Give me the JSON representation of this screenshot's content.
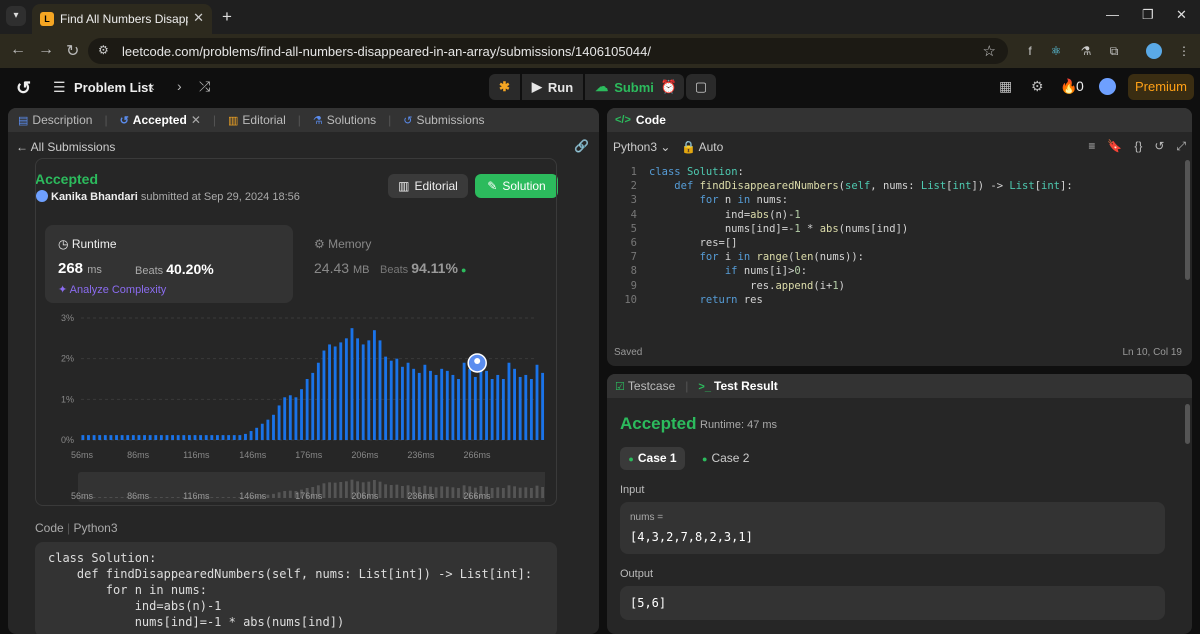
{
  "browser": {
    "tab_title": "Find All Numbers Disappeared in an Array",
    "url": "leetcode.com/problems/find-all-numbers-disappeared-in-an-array/submissions/1406105044/"
  },
  "header": {
    "problem_list": "Problem List",
    "run_label": "Run",
    "submit_label": "Submit",
    "streak_count": "0",
    "premium_label": "Premium"
  },
  "left_tabs": [
    {
      "label": "Description"
    },
    {
      "label": "Accepted"
    },
    {
      "label": "Editorial"
    },
    {
      "label": "Solutions"
    },
    {
      "label": "Submissions"
    }
  ],
  "submission": {
    "back_label": "All Submissions",
    "status": "Accepted",
    "user": "Kanika Bhandari",
    "submitted_text": "submitted at Sep 29, 2024 18:56",
    "editorial_btn": "Editorial",
    "solution_btn": "Solution",
    "runtime_label": "Runtime",
    "runtime_value": "268",
    "runtime_unit": "ms",
    "beats_label": "Beats",
    "runtime_beats": "40.20%",
    "analyze_label": "Analyze Complexity",
    "memory_label": "Memory",
    "memory_value": "24.43",
    "memory_unit": "MB",
    "memory_beats": "94.11%",
    "code_label": "Code",
    "code_lang": "Python3"
  },
  "chart_data": {
    "type": "bar",
    "y_ticks": [
      "0%",
      "1%",
      "2%",
      "3%"
    ],
    "ylim": [
      0,
      3
    ],
    "x_ticks": [
      "56ms",
      "86ms",
      "116ms",
      "146ms",
      "176ms",
      "206ms",
      "236ms",
      "266ms"
    ],
    "xlim": [
      56,
      300
    ],
    "bin_width_ms": 3,
    "x_start_ms": 57,
    "highlight_runtime_ms": 268,
    "values": [
      0.12,
      0.12,
      0.12,
      0.12,
      0.12,
      0.12,
      0.12,
      0.12,
      0.12,
      0.12,
      0.12,
      0.12,
      0.12,
      0.12,
      0.12,
      0.12,
      0.12,
      0.12,
      0.12,
      0.12,
      0.12,
      0.12,
      0.12,
      0.12,
      0.12,
      0.12,
      0.12,
      0.12,
      0.12,
      0.15,
      0.22,
      0.3,
      0.4,
      0.5,
      0.62,
      0.85,
      1.05,
      1.1,
      1.05,
      1.25,
      1.5,
      1.65,
      1.9,
      2.2,
      2.35,
      2.3,
      2.4,
      2.5,
      2.75,
      2.5,
      2.35,
      2.45,
      2.7,
      2.45,
      2.05,
      1.95,
      2.0,
      1.8,
      1.9,
      1.75,
      1.65,
      1.85,
      1.7,
      1.6,
      1.75,
      1.7,
      1.6,
      1.5,
      1.9,
      1.75,
      1.55,
      1.8,
      1.7,
      1.5,
      1.6,
      1.5,
      1.9,
      1.75,
      1.55,
      1.6,
      1.5,
      1.85,
      1.65,
      1.3,
      1.55,
      1.45,
      1.9,
      1.8,
      1.65,
      1.6,
      1.25,
      1.1,
      1.15,
      1.0,
      0.8,
      0.95,
      1.0,
      1.9,
      1.35
    ]
  },
  "submitted_code": [
    "class Solution:",
    "    def findDisappearedNumbers(self, nums: List[int]) -> List[int]:",
    "        for n in nums:",
    "            ind=abs(n)-1",
    "            nums[ind]=-1 * abs(nums[ind])"
  ],
  "editor": {
    "title": "Code",
    "language": "Python3",
    "auto_label": "Auto",
    "line_numbers": [
      "1",
      "2",
      "3",
      "4",
      "5",
      "6",
      "7",
      "8",
      "9",
      "10"
    ],
    "lines": [
      "class Solution:",
      "    def findDisappearedNumbers(self, nums: List[int]) -> List[int]:",
      "        for n in nums:",
      "            ind=abs(n)-1",
      "            nums[ind]=-1 * abs(nums[ind])",
      "        res=[]",
      "        for i in range(len(nums)):",
      "            if nums[i]>0:",
      "                res.append(i+1)",
      "        return res"
    ],
    "saved_label": "Saved",
    "cursor_pos": "Ln 10, Col 19"
  },
  "result": {
    "testcase_tab": "Testcase",
    "result_tab": "Test Result",
    "status": "Accepted",
    "runtime": "Runtime: 47 ms",
    "case1": "Case 1",
    "case2": "Case 2",
    "input_label": "Input",
    "input_var": "nums =",
    "input_value": "[4,3,2,7,8,2,3,1]",
    "output_label": "Output",
    "output_value": "[5,6]"
  },
  "colors": {
    "accent_green": "#2cbb5d",
    "bar_blue": "#1a73e8",
    "premium_orange": "#ffa116"
  }
}
